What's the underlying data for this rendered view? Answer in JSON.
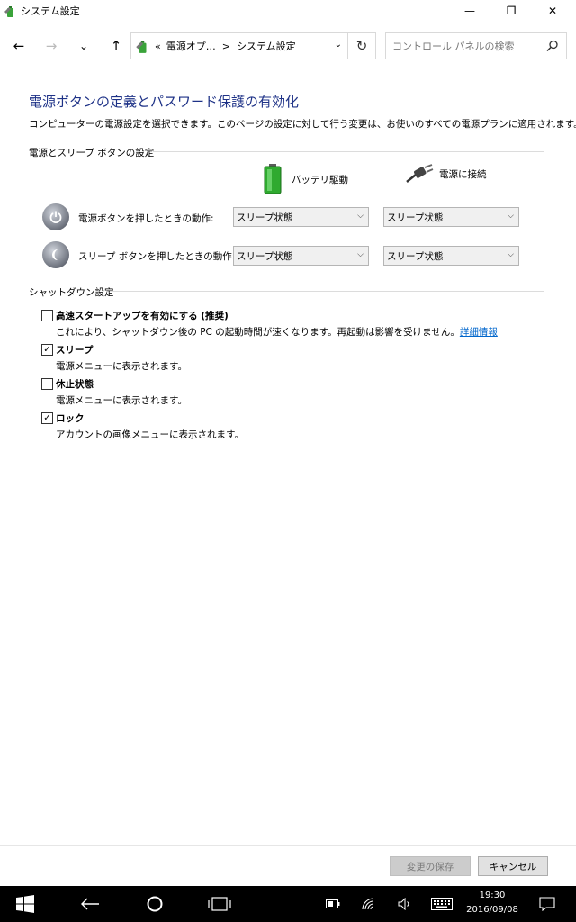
{
  "window": {
    "title": "システム設定",
    "minimize": "—",
    "restore": "❐",
    "close": "✕"
  },
  "nav": {
    "back": "←",
    "forward": "→",
    "recent": "⌄",
    "up": "↑",
    "address": {
      "prefix": "«",
      "crumbs": [
        "電源オプ…",
        "システム設定"
      ],
      "separator": ">",
      "dropdown": "⌄"
    },
    "refresh": "↻",
    "search_placeholder": "コントロール パネルの検索"
  },
  "main": {
    "heading": "電源ボタンの定義とパスワード保護の有効化",
    "description": "コンピューターの電源設定を選択できます。このページの設定に対して行う変更は、お使いのすべての電源プランに適用されます。",
    "power_group": {
      "title": "電源とスリープ ボタンの設定",
      "col_battery": "バッテリ駆動",
      "col_plugged": "電源に接続",
      "rows": [
        {
          "label": "電源ボタンを押したときの動作:",
          "battery": "スリープ状態",
          "plugged": "スリープ状態"
        },
        {
          "label": "スリープ ボタンを押したときの動作:",
          "battery": "スリープ状態",
          "plugged": "スリープ状態"
        }
      ]
    },
    "shutdown_group": {
      "title": "シャットダウン設定",
      "items": [
        {
          "label": "高速スタートアップを有効にする (推奨)",
          "desc": "これにより、シャットダウン後の PC の起動時間が速くなります。再起動は影響を受けません。",
          "link": "詳細情報",
          "checked": false
        },
        {
          "label": "スリープ",
          "desc": "電源メニューに表示されます。",
          "checked": true
        },
        {
          "label": "休止状態",
          "desc": "電源メニューに表示されます。",
          "checked": false
        },
        {
          "label": "ロック",
          "desc": "アカウントの画像メニューに表示されます。",
          "checked": true
        }
      ]
    }
  },
  "footer": {
    "save": "変更の保存",
    "cancel": "キャンセル"
  },
  "taskbar": {
    "time": "19:30",
    "date": "2016/09/08"
  },
  "colors": {
    "heading": "#1e3287",
    "link": "#0066cc",
    "taskbar": "#000000"
  }
}
